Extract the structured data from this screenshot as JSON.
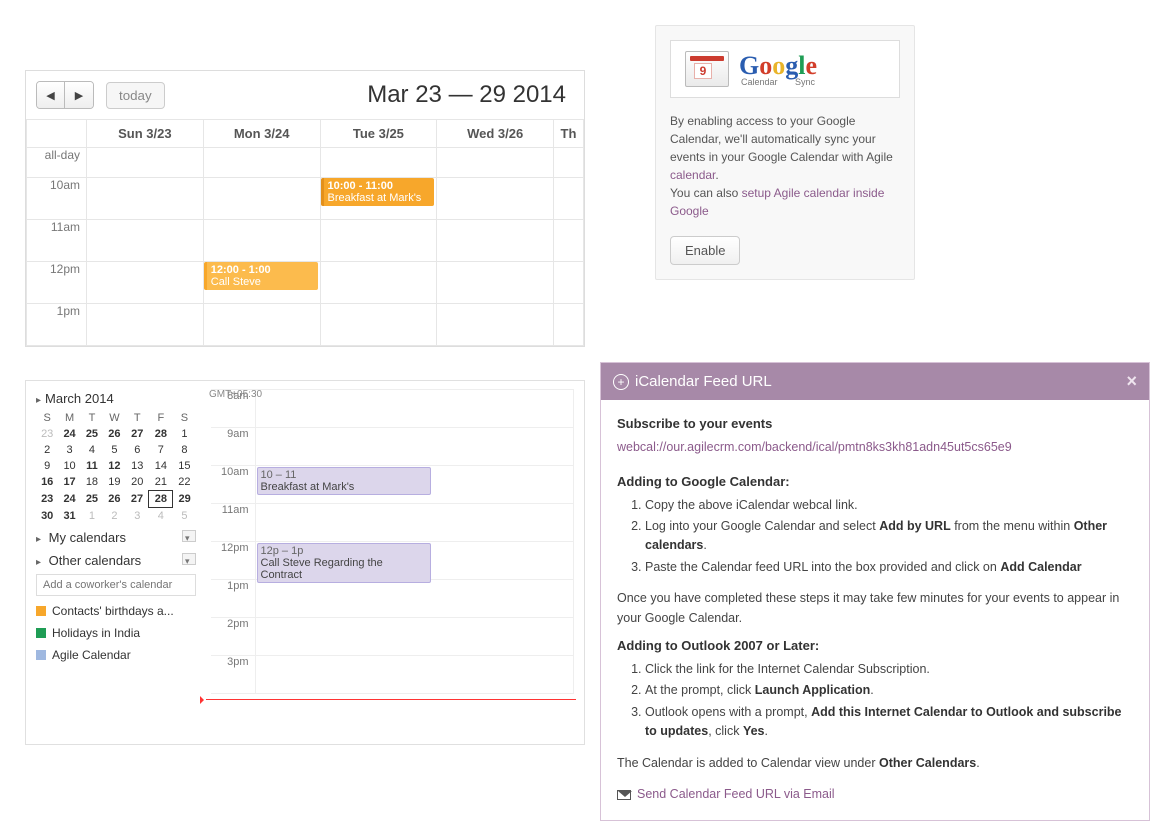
{
  "week": {
    "title": "Mar 23 — 29 2014",
    "today_label": "today",
    "days": [
      "Sun 3/23",
      "Mon 3/24",
      "Tue 3/25",
      "Wed 3/26",
      "Th"
    ],
    "allday_label": "all-day",
    "hours": [
      "10am",
      "11am",
      "12pm",
      "1pm"
    ],
    "events": {
      "breakfast": {
        "time": "10:00 - 11:00",
        "title": "Breakfast at Mark's"
      },
      "call": {
        "time": "12:00 - 1:00",
        "title": "Call Steve"
      }
    }
  },
  "gcal": {
    "month_title": "March 2014",
    "tz": "GMT+05:30",
    "dow": [
      "S",
      "M",
      "T",
      "W",
      "T",
      "F",
      "S"
    ],
    "weeks": [
      [
        {
          "d": "23",
          "dim": true
        },
        {
          "d": "24",
          "b": true
        },
        {
          "d": "25",
          "b": true
        },
        {
          "d": "26",
          "b": true
        },
        {
          "d": "27",
          "b": true
        },
        {
          "d": "28",
          "b": true
        },
        {
          "d": "1"
        }
      ],
      [
        {
          "d": "2"
        },
        {
          "d": "3"
        },
        {
          "d": "4"
        },
        {
          "d": "5"
        },
        {
          "d": "6"
        },
        {
          "d": "7"
        },
        {
          "d": "8"
        }
      ],
      [
        {
          "d": "9"
        },
        {
          "d": "10"
        },
        {
          "d": "11",
          "b": true
        },
        {
          "d": "12",
          "b": true
        },
        {
          "d": "13"
        },
        {
          "d": "14"
        },
        {
          "d": "15"
        }
      ],
      [
        {
          "d": "16",
          "b": true
        },
        {
          "d": "17",
          "b": true
        },
        {
          "d": "18"
        },
        {
          "d": "19"
        },
        {
          "d": "20"
        },
        {
          "d": "21"
        },
        {
          "d": "22"
        }
      ],
      [
        {
          "d": "23",
          "b": true
        },
        {
          "d": "24",
          "b": true
        },
        {
          "d": "25",
          "b": true
        },
        {
          "d": "26",
          "b": true
        },
        {
          "d": "27",
          "b": true
        },
        {
          "d": "28",
          "b": true,
          "today": true
        },
        {
          "d": "29",
          "b": true
        }
      ],
      [
        {
          "d": "30",
          "b": true
        },
        {
          "d": "31",
          "b": true
        },
        {
          "d": "1",
          "dim": true
        },
        {
          "d": "2",
          "dim": true
        },
        {
          "d": "3",
          "dim": true
        },
        {
          "d": "4",
          "dim": true
        },
        {
          "d": "5",
          "dim": true
        }
      ]
    ],
    "my_cal_label": "My calendars",
    "other_cal_label": "Other calendars",
    "add_placeholder": "Add a coworker's calendar",
    "cals": [
      {
        "color": "#f7a72b",
        "name": "Contacts' birthdays a..."
      },
      {
        "color": "#1f9d55",
        "name": "Holidays in India"
      },
      {
        "color": "#9fb8e0",
        "name": "Agile Calendar"
      }
    ],
    "hours": [
      "8am",
      "9am",
      "10am",
      "11am",
      "12pm",
      "1pm",
      "2pm",
      "3pm"
    ],
    "events": {
      "breakfast": {
        "time": "10 – 11",
        "title": "Breakfast at Mark's"
      },
      "call": {
        "time": "12p – 1p",
        "title": "Call Steve Regarding the Contract"
      }
    }
  },
  "sync": {
    "logo_sub_left": "Calendar",
    "logo_sub_right": "Sync",
    "text1": "By enabling access to your Google Calendar, we'll automatically sync your events in your Google Calendar with Agile ",
    "link1": "calendar",
    "text2": "You can also ",
    "link2": "setup Agile calendar inside Google",
    "enable": "Enable"
  },
  "ical": {
    "title": "iCalendar Feed URL",
    "sub_heading": "Subscribe to your events",
    "webcal": "webcal://our.agilecrm.com/backend/ical/pmtn8ks3kh81adn45ut5cs65e9",
    "g_heading": "Adding to Google Calendar:",
    "g_steps": [
      "Copy the above iCalendar webcal link.",
      "Log into your Google Calendar and select <b>Add by URL</b> from the menu within <b>Other calendars</b>.",
      "Paste the Calendar feed URL into the box provided and click on <b>Add Calendar</b>"
    ],
    "g_note": "Once you have completed these steps it may take few minutes for your events to appear in your Google Calendar.",
    "o_heading": "Adding to Outlook 2007 or Later:",
    "o_steps": [
      "Click the link for the Internet Calendar Subscription.",
      "At the prompt, click <b>Launch Application</b>.",
      "Outlook opens with a prompt, <b>Add this Internet Calendar to Outlook and subscribe to updates</b>, click <b>Yes</b>."
    ],
    "o_note": "The Calendar is added to Calendar view under <b>Other Calendars</b>.",
    "email_link": "Send Calendar Feed URL via Email"
  }
}
